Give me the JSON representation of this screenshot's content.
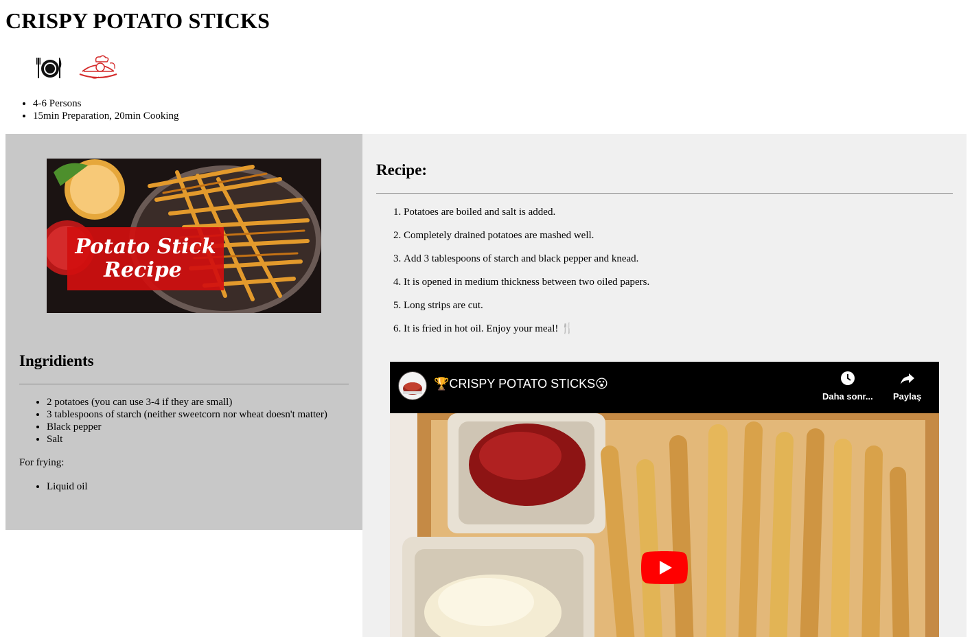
{
  "recipe": {
    "title": "CRISPY POTATO STICKS",
    "icons": [
      "plate-icon",
      "chef-icon"
    ],
    "meta": [
      "4-6 Persons",
      "15min Preparation, 20min Cooking"
    ]
  },
  "thumbnail": {
    "line1": "Potato Stick",
    "line2": "Recipe"
  },
  "ingredients": {
    "title": "Ingridients",
    "items": [
      "2 potatoes (you can use 3-4 if they are small)",
      "3 tablespoons of starch (neither sweetcorn nor wheat doesn't matter)",
      "Black pepper",
      "Salt"
    ],
    "frying_label": "For frying:",
    "frying_items": [
      "Liquid oil"
    ]
  },
  "instructions": {
    "title": "Recipe:",
    "steps": [
      "Potatoes are boiled and salt is added.",
      "Completely drained potatoes are mashed well.",
      "Add 3 tablespoons of starch and black pepper and knead.",
      "It is opened in medium thickness between two oiled papers.",
      "Long strips are cut.",
      "It is fried in hot oil. Enjoy your meal! 🍴"
    ]
  },
  "video": {
    "title": "🏆CRISPY POTATO STICKS😮",
    "watch_later": "Daha sonr...",
    "share": "Paylaş",
    "icons": [
      "clock-icon",
      "share-icon",
      "play-icon"
    ],
    "colors": {
      "play": "#ff0000",
      "bar": "#000000"
    }
  },
  "colors": {
    "left_panel": "#c8c8c8",
    "right_panel": "#f0f0f0",
    "thumb_banner": "#d10f0f"
  }
}
